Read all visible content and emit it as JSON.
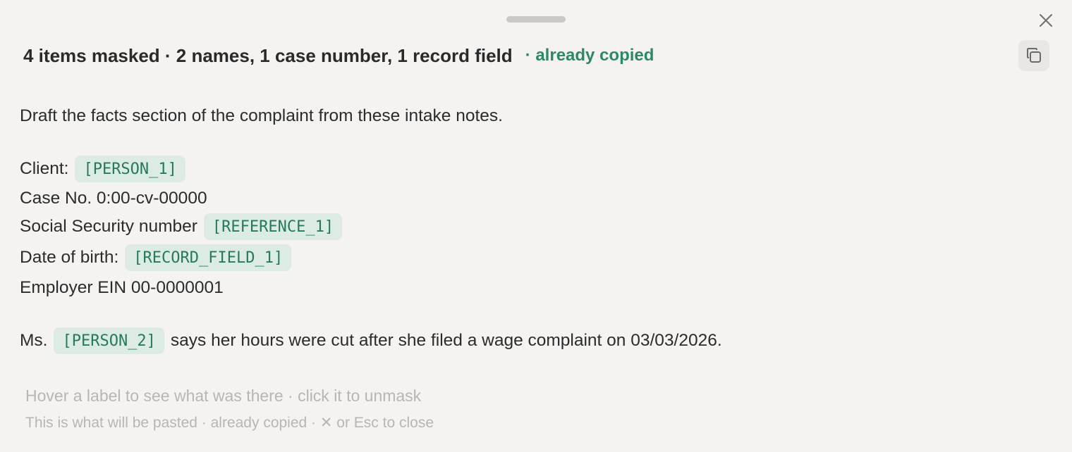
{
  "panel": {
    "close_icon": "close-icon",
    "copy_icon": "copy-icon"
  },
  "header": {
    "summary": "4 items masked · 2 names, 1 case number, 1 record field",
    "status": "· already copied"
  },
  "content": {
    "instruction": "Draft the facts section of the complaint from these intake notes.",
    "client_label": "Client:",
    "client_chip": "[PERSON_1]",
    "case_line": "Case No. 0:00-cv-00000",
    "ssn_label": "Social Security number",
    "ssn_chip": "[REFERENCE_1]",
    "dob_label": "Date of birth:",
    "dob_chip": "[RECORD_FIELD_1]",
    "employer_line": "Employer EIN 00-0000001",
    "sentence_prefix": "Ms.",
    "sentence_chip": "[PERSON_2]",
    "sentence_suffix": "says her hours were cut after she filed a wage complaint on 03/03/2026."
  },
  "footer": {
    "hint_primary": "Hover a label to see what was there · click it to unmask",
    "hint_secondary": "This is what will be pasted · already copied · ✕ or Esc to close"
  },
  "colors": {
    "background": "#f4f3f1",
    "accent": "#2a8a66",
    "chip_background": "#dcece4",
    "chip_text": "#257a5b",
    "muted_text": "#b7b6b3"
  }
}
